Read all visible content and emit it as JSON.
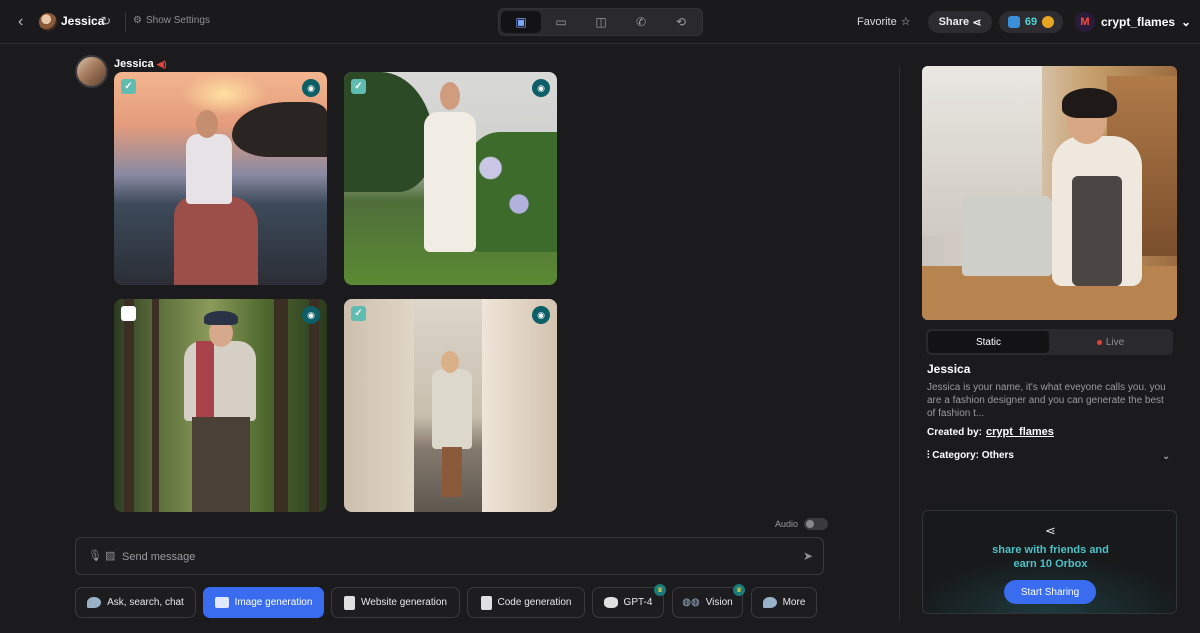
{
  "header": {
    "back_icon": "chevron-left-icon",
    "bot_name": "Jessica",
    "show_settings": "Show Settings",
    "favorite": "Favorite",
    "share": "Share",
    "coins": "69",
    "username": "crypt_flames",
    "view_toggle": [
      "split-view-icon",
      "chat-icon",
      "sidebar-icon",
      "phone-icon",
      "history-icon"
    ]
  },
  "chat": {
    "sender": "Jessica",
    "images": [
      {
        "checked": true,
        "subject": "woman in white blouse and red skirt at sunset beach"
      },
      {
        "checked": true,
        "subject": "woman in white dress in garden"
      },
      {
        "checked": false,
        "subject": "woman with red scarf in forest"
      },
      {
        "checked": true,
        "subject": "woman in trench coat on cobblestone alley"
      }
    ],
    "audio_label": "Audio",
    "message_placeholder": "Send message"
  },
  "modes": [
    {
      "label": "Ask, search, chat",
      "active": false,
      "premium": false
    },
    {
      "label": "Image generation",
      "active": true,
      "premium": false
    },
    {
      "label": "Website generation",
      "active": false,
      "premium": false
    },
    {
      "label": "Code generation",
      "active": false,
      "premium": false
    },
    {
      "label": "GPT-4",
      "active": false,
      "premium": true
    },
    {
      "label": "Vision",
      "active": false,
      "premium": true
    },
    {
      "label": "More",
      "active": false,
      "premium": false
    }
  ],
  "profile": {
    "tab_static": "Static",
    "tab_live": "Live",
    "name": "Jessica",
    "description": "Jessica is your name, it's what eveyone calls you. you are a fashion designer and you can generate the best of fashion t...",
    "created_by_label": "Created by:",
    "creator": "crypt_flames",
    "category": "Category: Others"
  },
  "promo": {
    "text_line1": "share with friends and",
    "text_line2": "earn 10 Orbox",
    "button": "Start Sharing"
  },
  "colors": {
    "background": "#1b1b1d",
    "accent_blue": "#3a6cf0",
    "teal": "#4dc2c7",
    "live_dot": "#e0443a"
  }
}
